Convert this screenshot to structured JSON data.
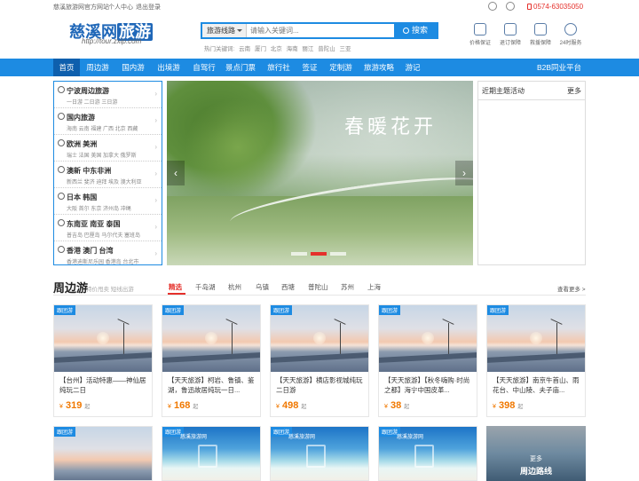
{
  "topbar": {
    "site_label": "慈溪旅游网官方网站",
    "user_center": "个人中心",
    "logout": "退出登录",
    "phone": "0574-63035050",
    "icons": [
      "weibo-icon",
      "wechat-icon",
      "mobile-icon"
    ]
  },
  "logo": {
    "text_main": "慈溪网",
    "text_hl": "旅游",
    "url": "http://tour.zxip.com"
  },
  "search": {
    "select_value": "旅游线路",
    "placeholder": "请输入关键词...",
    "button": "搜索"
  },
  "hotwords": {
    "label": "热门关键词:",
    "items": [
      "云南",
      "厦门",
      "北京",
      "海南",
      "丽江",
      "普陀山",
      "三亚"
    ]
  },
  "badges": [
    {
      "label": "价格保证",
      "icon": "price-guarantee-icon"
    },
    {
      "label": "退订保障",
      "icon": "refund-guarantee-icon"
    },
    {
      "label": "救援保障",
      "icon": "rescue-guarantee-icon"
    },
    {
      "label": "24时服务",
      "icon": "clock-service-icon"
    }
  ],
  "nav": {
    "items": [
      "首页",
      "周边游",
      "国内游",
      "出境游",
      "自驾行",
      "景点门票",
      "旅行社",
      "签证",
      "定制游",
      "旅游攻略",
      "游记"
    ],
    "active": "首页",
    "right": "B2B同业平台"
  },
  "categories": [
    {
      "title": "宁波周边旅游",
      "sub": "一日游 二日游 三日游"
    },
    {
      "title": "国内旅游",
      "sub": "海南 云南 福建 广西 北京 西藏"
    },
    {
      "title": "欧洲 美洲",
      "sub": "瑞士 法国 美国 加拿大 俄罗斯"
    },
    {
      "title": "澳新 中东非洲",
      "sub": "新西兰 斐济 迪拜 埃及 澳大利亚"
    },
    {
      "title": "日本 韩国",
      "sub": "大阪 首尔 东京 济州岛 冲绳"
    },
    {
      "title": "东南亚 南亚 泰国",
      "sub": "普吉岛 巴厘岛 马尔代夫 塞班岛"
    },
    {
      "title": "香港 澳门 台湾",
      "sub": "香港迪斯尼乐园 香港岛 台北市"
    }
  ],
  "banner": {
    "title": "春暖花开",
    "prev": "‹",
    "next": "›",
    "dots_total": 4,
    "dots_active": 2
  },
  "activity": {
    "title": "近期主题活动",
    "more": "更多"
  },
  "section": {
    "title": "周边游",
    "subtitle": "特价甩卖 短线出游",
    "tabs": [
      "精选",
      "千岛湖",
      "杭州",
      "乌镇",
      "西塘",
      "普陀山",
      "苏州",
      "上海"
    ],
    "active_tab": "精选",
    "more": "查看更多 >"
  },
  "products": [
    {
      "tag": "跟团游",
      "name": "【台州】活动特惠——神仙居纯玩二日",
      "price": "319",
      "currency": "¥",
      "suffix": "起"
    },
    {
      "tag": "跟团游",
      "name": "【天天旅游】柯岩、鲁镇、鉴湖，鲁迅故居纯玩一日...",
      "price": "168",
      "currency": "¥",
      "suffix": "起"
    },
    {
      "tag": "跟团游",
      "name": "【天天旅游】横店影视城纯玩二日游",
      "price": "498",
      "currency": "¥",
      "suffix": "起"
    },
    {
      "tag": "跟团游",
      "name": "【天天旅游】【秋冬嗨购·时尚之都】海宁中国皮革...",
      "price": "38",
      "currency": "¥",
      "suffix": "起"
    },
    {
      "tag": "跟团游",
      "name": "【天天旅游】南京牛首山、雨花台、中山陵、夫子庙...",
      "price": "398",
      "currency": "¥",
      "suffix": "起"
    }
  ],
  "row2": [
    {
      "tag": "跟团游",
      "style": "wind"
    },
    {
      "tag": "跟团游",
      "style": "beach",
      "watermark": "慈溪旅游网"
    },
    {
      "tag": "跟团游",
      "style": "beach",
      "watermark": "慈溪旅游网"
    },
    {
      "tag": "跟团游",
      "style": "beach",
      "watermark": "慈溪旅游网"
    }
  ],
  "more_card": {
    "line1": "更多",
    "line2": "周边路线"
  },
  "colors": {
    "brand_blue": "#1d8be2",
    "nav_active": "#0e5fad",
    "price_orange": "#f07800",
    "accent_red": "#e5302b"
  }
}
